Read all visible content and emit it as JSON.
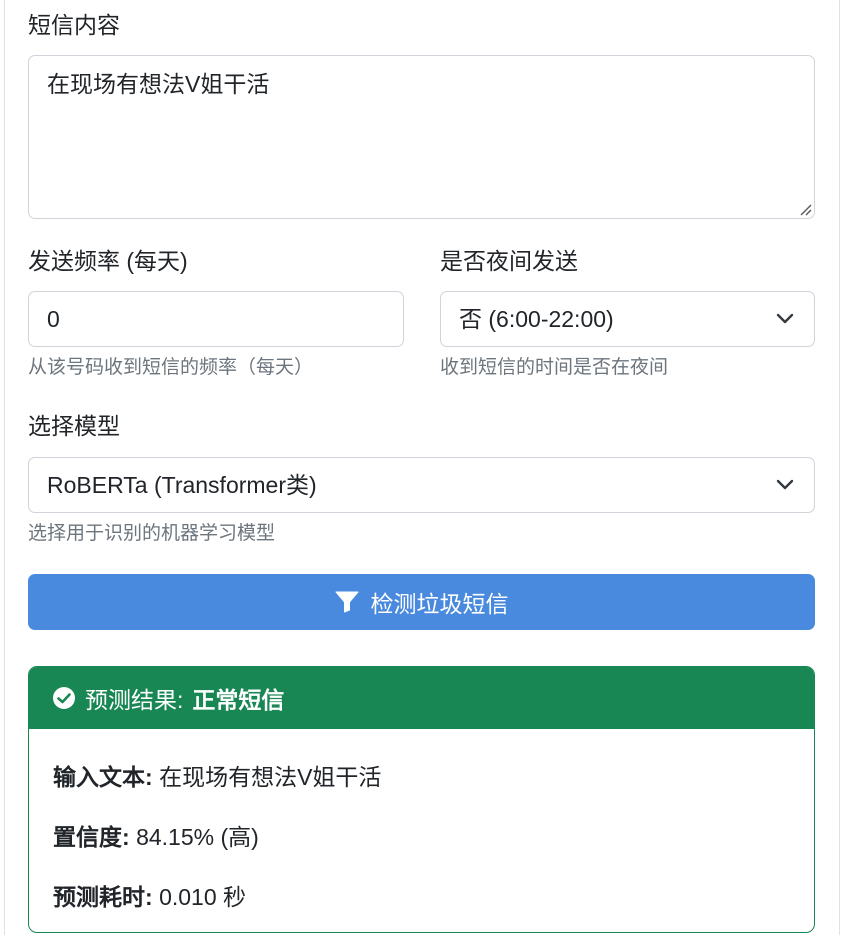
{
  "form": {
    "message_label": "短信内容",
    "message_value": "在现场有想法V姐干活",
    "frequency_label": "发送频率 (每天)",
    "frequency_value": "0",
    "frequency_help": "从该号码收到短信的频率（每天）",
    "night_label": "是否夜间发送",
    "night_selected": "否 (6:00-22:00)",
    "night_help": "收到短信的时间是否在夜间",
    "model_label": "选择模型",
    "model_selected": "RoBERTa (Transformer类)",
    "model_help": "选择用于识别的机器学习模型",
    "detect_button": "检测垃圾短信"
  },
  "result": {
    "header_prefix": "预测结果:",
    "header_value": "正常短信",
    "input_label": "输入文本:",
    "input_value": "在现场有想法V姐干活",
    "confidence_label": "置信度:",
    "confidence_value": "84.15% (高)",
    "time_label": "预测耗时:",
    "time_value": "0.010 秒"
  },
  "colors": {
    "primary_button": "#4a8ade",
    "success": "#198754",
    "muted_text": "#6c757d",
    "border": "#ced4da"
  },
  "icons": {
    "detect_button_icon": "filter-icon",
    "result_header_icon": "check-circle-icon",
    "select_icon": "chevron-down-icon"
  }
}
